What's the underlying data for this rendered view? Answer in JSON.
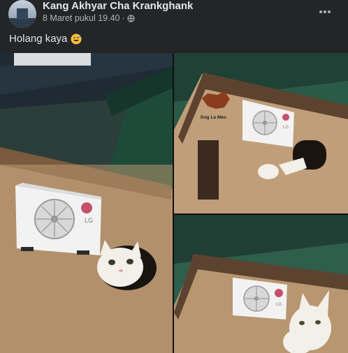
{
  "post": {
    "author": "Kang Akhyar Cha Krankghank",
    "timestamp": "8 Maret pukul 19.40",
    "visibility_separator": "·",
    "privacy_icon": "globe-icon",
    "caption": "Holang kaya",
    "caption_emoji": "grinning-sweat-emoji",
    "more_icon": "more-dots-icon"
  },
  "photo": {
    "watermark": "Dog Là Mèo",
    "ac_brand": "LG"
  },
  "colors": {
    "background": "#242526",
    "text_primary": "#e4e6eb",
    "text_secondary": "#b0b3b8"
  }
}
